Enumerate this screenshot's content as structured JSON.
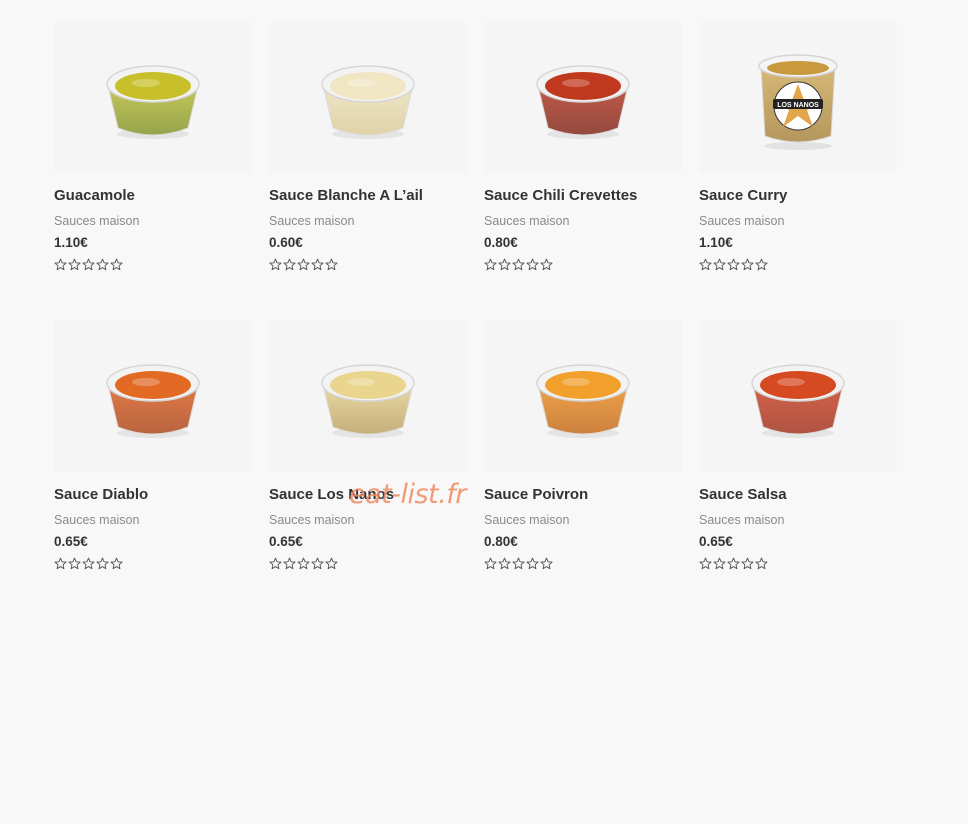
{
  "products": [
    {
      "name": "Guacamole",
      "category": "Sauces maison",
      "price": "1.10€",
      "rating": 0,
      "colors": {
        "sauce": "#b7b830",
        "dark": "#7b8e1f",
        "top": "#c7c02a"
      }
    },
    {
      "name": "Sauce Blanche A L’ail",
      "category": "Sauces maison",
      "price": "0.60€",
      "rating": 0,
      "colors": {
        "sauce": "#eadfb8",
        "dark": "#d8c894",
        "top": "#f1e6c4"
      }
    },
    {
      "name": "Sauce Chili Crevettes",
      "category": "Sauces maison",
      "price": "0.80€",
      "rating": 0,
      "colors": {
        "sauce": "#b1301b",
        "dark": "#7a1d10",
        "top": "#c0391e"
      }
    },
    {
      "name": "Sauce Curry",
      "category": "Sauces maison",
      "price": "1.10€",
      "rating": 0,
      "colors": {
        "sauce": "#c9a14a",
        "dark": "#9c7327",
        "top": "#c89a3d"
      },
      "label": "LOS NANOS"
    },
    {
      "name": "Sauce Diablo",
      "category": "Sauces maison",
      "price": "0.65€",
      "rating": 0,
      "colors": {
        "sauce": "#d9581a",
        "dark": "#a63e10",
        "top": "#e26a25"
      }
    },
    {
      "name": "Sauce Los Nanos",
      "category": "Sauces maison",
      "price": "0.65€",
      "rating": 0,
      "colors": {
        "sauce": "#e3cf8c",
        "dark": "#b89a59",
        "top": "#ead58f"
      }
    },
    {
      "name": "Sauce Poivron",
      "category": "Sauces maison",
      "price": "0.80€",
      "rating": 0,
      "colors": {
        "sauce": "#e98b1d",
        "dark": "#c0620e",
        "top": "#f0a02b"
      }
    },
    {
      "name": "Sauce Salsa",
      "category": "Sauces maison",
      "price": "0.65€",
      "rating": 0,
      "colors": {
        "sauce": "#c73a1b",
        "dark": "#9b2a13",
        "top": "#d64a22"
      }
    }
  ],
  "watermark": "eat-list.fr",
  "colors": {
    "background": "#f8f8f8",
    "text": "#333333",
    "muted": "#8a8a8a",
    "star_outline": "#555555",
    "watermark": "#ef8a62"
  }
}
